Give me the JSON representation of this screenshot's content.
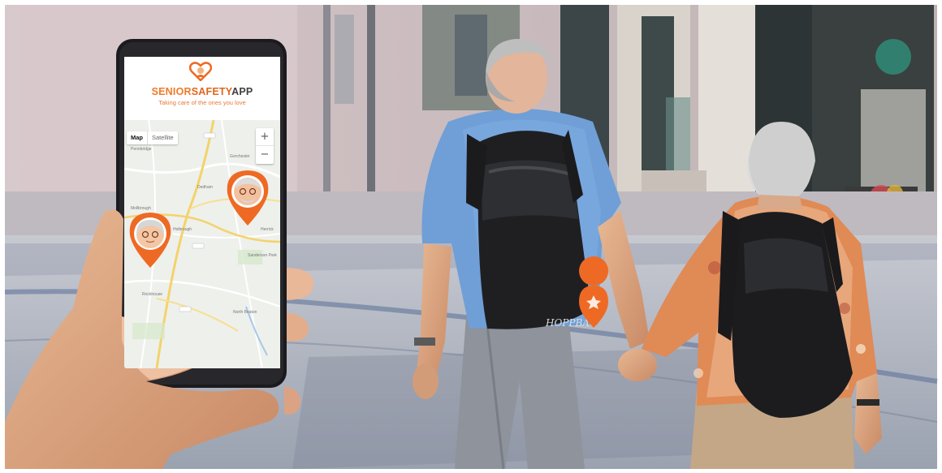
{
  "app": {
    "brand_part1": "SENIOR",
    "brand_part2": "SAFETY",
    "brand_part3": "APP",
    "tagline": "Taking care of the ones you love"
  },
  "map": {
    "map_type_map": "Map",
    "map_type_satellite": "Satellite",
    "zoom_in": "+",
    "zoom_out": "−",
    "place_labels": [
      "Pennbridge",
      "Gorchester",
      "Mollbrough",
      "Dedham",
      "Holbrough",
      "North Beaton",
      "Sanderson Park",
      "Herrick",
      "Rockhouse"
    ]
  },
  "backpack": {
    "brand": "HOPPBAG"
  },
  "colors": {
    "accent_orange": "#ee6a24",
    "map_bg": "#eef0ec",
    "road_yellow": "#f3d36b"
  },
  "icons": [
    "heart-logo-icon",
    "location-pin-icon",
    "location-pin-icon",
    "location-pin-icon"
  ]
}
